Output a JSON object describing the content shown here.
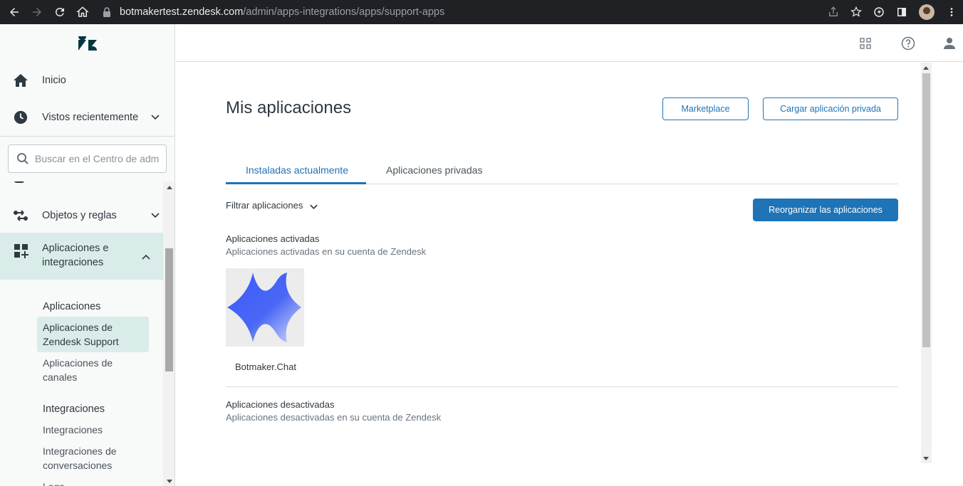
{
  "browser": {
    "url_domain": "botmakertest.zendesk.com",
    "url_path": "/admin/apps-integrations/apps/support-apps"
  },
  "sidebar": {
    "home": "Inicio",
    "recent": "Vistos recientemente",
    "search_placeholder": "Buscar en el Centro de admi",
    "objects": "Objetos y reglas",
    "apps_line1": "Aplicaciones e",
    "apps_line2": "integraciones",
    "sub": {
      "apps_heading": "Aplicaciones",
      "support_apps_line1": "Aplicaciones de",
      "support_apps_line2": "Zendesk Support",
      "channel_apps_line1": "Aplicaciones de",
      "channel_apps_line2": "canales",
      "integrations_heading": "Integraciones",
      "integrations": "Integraciones",
      "conv_integrations_line1": "Integraciones de",
      "conv_integrations_line2": "conversaciones",
      "logs": "Logs"
    }
  },
  "main": {
    "title": "Mis aplicaciones",
    "marketplace": "Marketplace",
    "upload_private": "Cargar aplicación privada",
    "tabs": [
      {
        "label": "Instaladas actualmente"
      },
      {
        "label": "Aplicaciones privadas"
      }
    ],
    "filter": "Filtrar aplicaciones",
    "reorder": "Reorganizar las aplicaciones",
    "enabled_title": "Aplicaciones activadas",
    "enabled_sub": "Aplicaciones activadas en su cuenta de Zendesk",
    "app_name": "Botmaker.Chat",
    "disabled_title": "Aplicaciones desactivadas",
    "disabled_sub": "Aplicaciones desactivadas en su cuenta de Zendesk"
  },
  "colors": {
    "accent": "#1f73b7",
    "sidebar_active": "#d9ece9",
    "browser_bg": "#202124"
  }
}
